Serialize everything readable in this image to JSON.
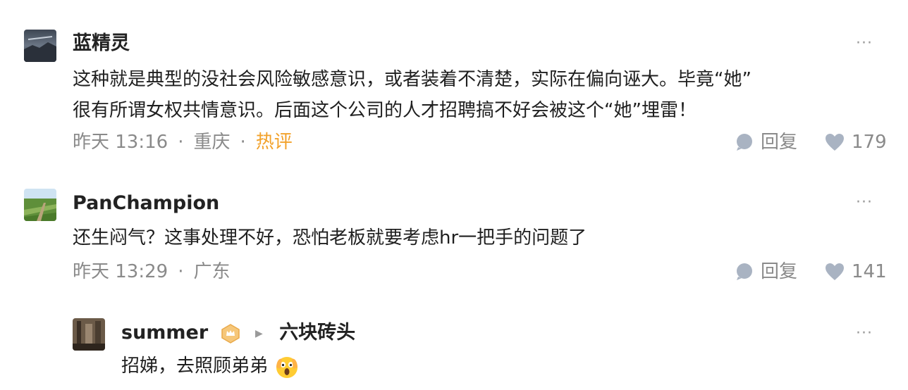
{
  "comments": [
    {
      "username": "蓝精灵",
      "avatar_icon": "avatar-landscape-dark",
      "text_line1": "这种就是典型的没社会风险敏感意识，或者装着不清楚，实际在偏向诬大。毕竟“她”",
      "text_line2": "很有所谓女权共情意识。后面这个公司的人才招聘搞不好会被这个“她”埋雷！",
      "time": "昨天 13:16",
      "location": "重庆",
      "hot": "热评",
      "reply_label": "回复",
      "likes": "179",
      "more": "···"
    },
    {
      "username": "PanChampion",
      "avatar_icon": "avatar-green-field",
      "text_line1": "还生闷气？这事处理不好，恐怕老板就要考虑hr一把手的问题了",
      "time": "昨天 13:29",
      "location": "广东",
      "reply_label": "回复",
      "likes": "141",
      "more": "···"
    }
  ],
  "reply": {
    "username": "summer",
    "reply_to": "六块砖头",
    "text": "招娣，去照顾弟弟",
    "emoji_icon": "scared-face-icon",
    "more": "···"
  },
  "colors": {
    "hot": "#f2a12a",
    "meta": "#8a8a8a",
    "icon": "#a9b3c2"
  }
}
